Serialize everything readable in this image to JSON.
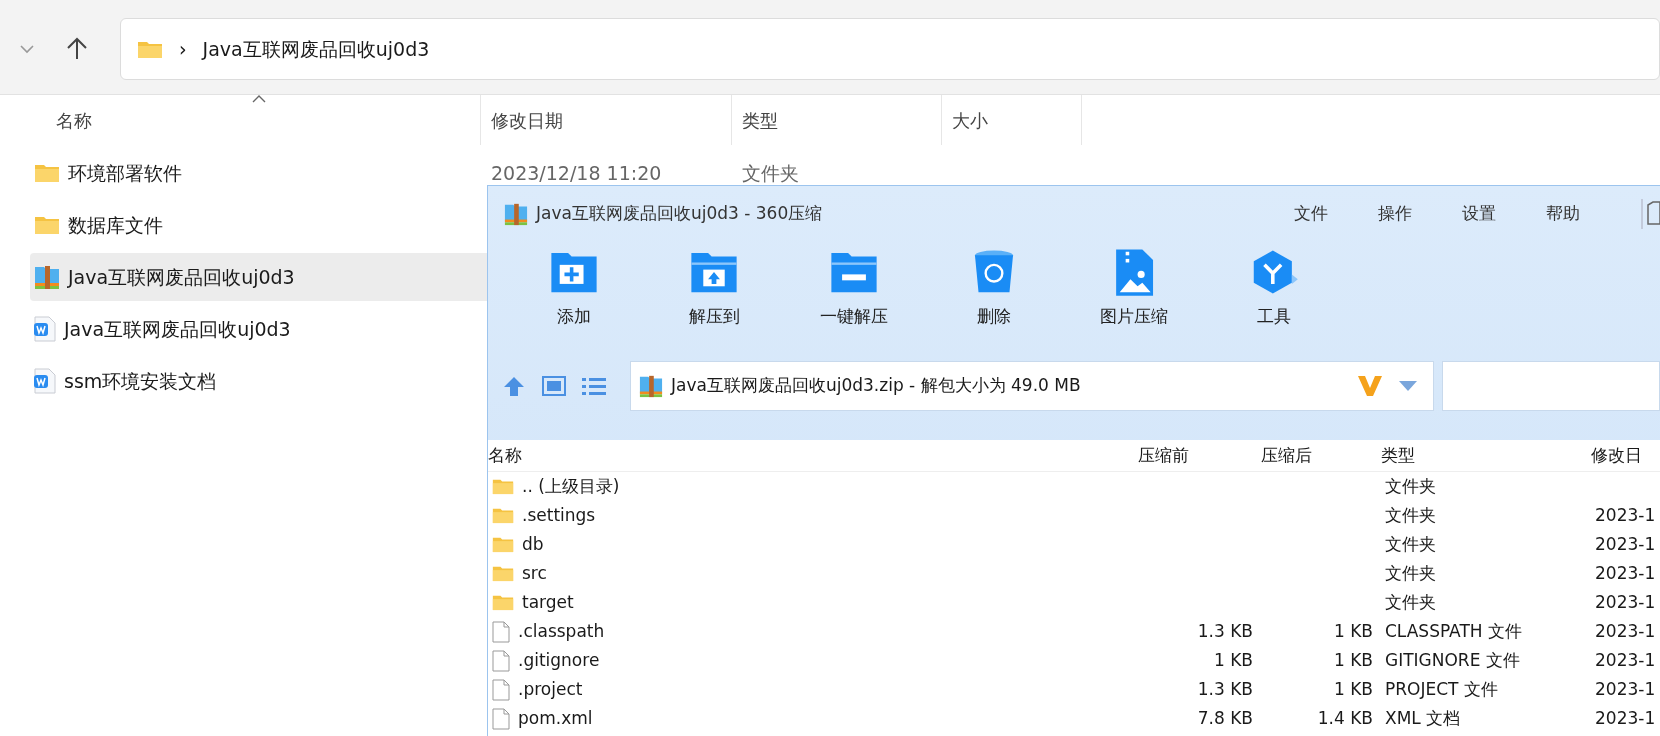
{
  "explorer": {
    "address": {
      "separator": "›",
      "path": "Java互联网废品回收uj0d3"
    },
    "columns": [
      "名称",
      "修改日期",
      "类型",
      "大小"
    ],
    "rows": [
      {
        "name": "环境部署软件",
        "kind": "folder",
        "date": "2023/12/18 11:20",
        "type": "文件夹",
        "selected": false
      },
      {
        "name": "数据库文件",
        "kind": "folder",
        "selected": false
      },
      {
        "name": "Java互联网废品回收uj0d3",
        "kind": "archive",
        "selected": true
      },
      {
        "name": "Java互联网废品回收uj0d3",
        "kind": "word",
        "selected": false
      },
      {
        "name": "ssm环境安装文档",
        "kind": "word",
        "selected": false
      }
    ]
  },
  "archiver": {
    "title": "Java互联网废品回收uj0d3 - 360压缩",
    "menu": [
      "文件",
      "操作",
      "设置",
      "帮助"
    ],
    "tools": [
      {
        "label": "添加",
        "kind": "add"
      },
      {
        "label": "解压到",
        "kind": "extract"
      },
      {
        "label": "一键解压",
        "kind": "quick"
      },
      {
        "label": "删除",
        "kind": "delete"
      },
      {
        "label": "图片压缩",
        "kind": "image"
      },
      {
        "label": "工具",
        "kind": "tools"
      }
    ],
    "address": "Java互联网废品回收uj0d3.zip - 解包大小为 49.0 MB",
    "columns": [
      "名称",
      "压缩前",
      "压缩后",
      "类型",
      "修改日"
    ],
    "rows": [
      {
        "name": ".. (上级目录)",
        "kind": "folder",
        "type": "文件夹"
      },
      {
        "name": ".settings",
        "kind": "folder",
        "type": "文件夹",
        "date": "2023-1"
      },
      {
        "name": "db",
        "kind": "folder",
        "type": "文件夹",
        "date": "2023-1"
      },
      {
        "name": "src",
        "kind": "folder",
        "type": "文件夹",
        "date": "2023-1"
      },
      {
        "name": "target",
        "kind": "folder",
        "type": "文件夹",
        "date": "2023-1"
      },
      {
        "name": ".classpath",
        "kind": "file",
        "before": "1.3 KB",
        "after": "1 KB",
        "type": "CLASSPATH 文件",
        "date": "2023-1"
      },
      {
        "name": ".gitignore",
        "kind": "file",
        "before": "1 KB",
        "after": "1 KB",
        "type": "GITIGNORE 文件",
        "date": "2023-1"
      },
      {
        "name": ".project",
        "kind": "file",
        "before": "1.3 KB",
        "after": "1 KB",
        "type": "PROJECT 文件",
        "date": "2023-1"
      },
      {
        "name": "pom.xml",
        "kind": "file",
        "before": "7.8 KB",
        "after": "1.4 KB",
        "type": "XML 文档",
        "date": "2023-1"
      }
    ]
  }
}
